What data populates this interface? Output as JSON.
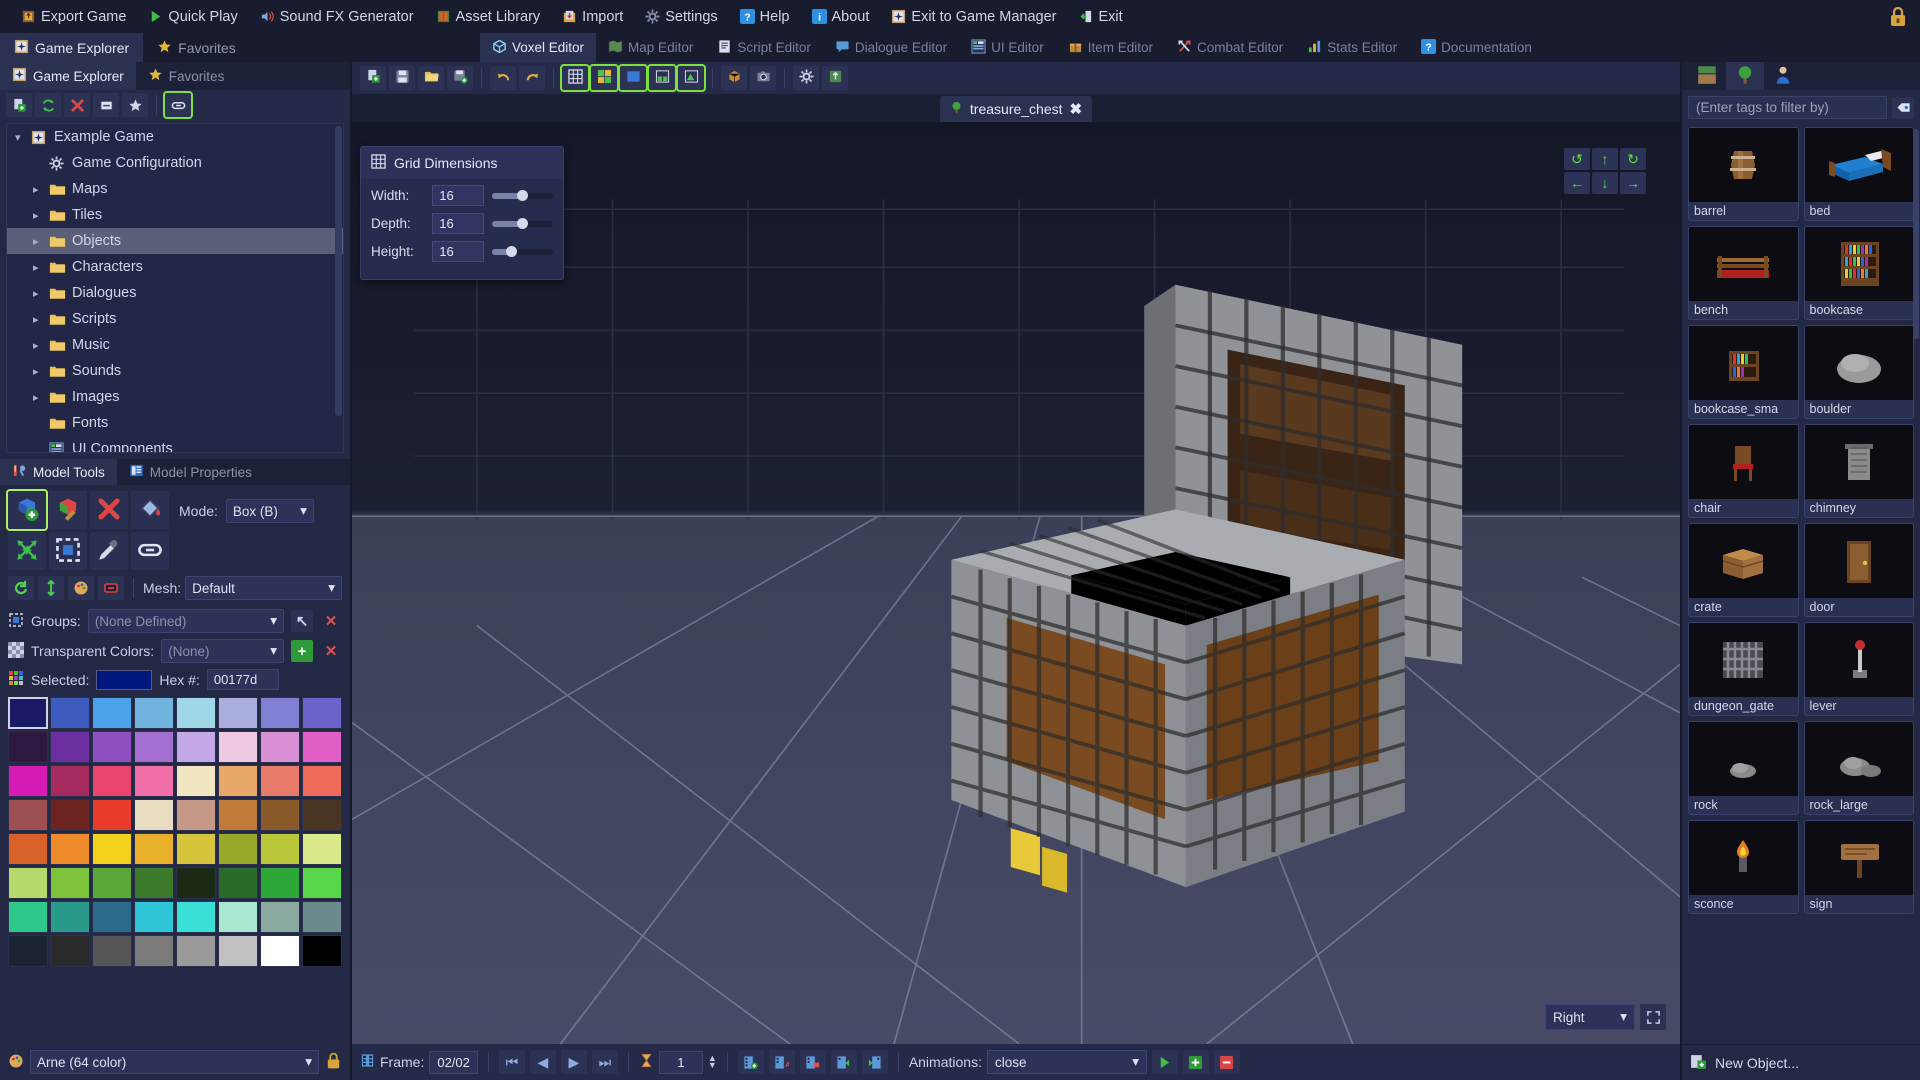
{
  "menubar": {
    "items": [
      {
        "label": "Export Game",
        "icon": "export-icon",
        "color": "#c87a2a"
      },
      {
        "label": "Quick Play",
        "icon": "play-icon",
        "color": "#3fbf4a"
      },
      {
        "label": "Sound FX Generator",
        "icon": "speaker-icon",
        "color": "#5b9be0"
      },
      {
        "label": "Asset Library",
        "icon": "library-icon",
        "color": "#4f9a4f"
      },
      {
        "label": "Import",
        "icon": "import-icon",
        "color": "#d08a2a"
      },
      {
        "label": "Settings",
        "icon": "gear-icon",
        "color": "#8b93b5"
      },
      {
        "label": "Help",
        "icon": "question-icon",
        "color": "#2f8fe0"
      },
      {
        "label": "About",
        "icon": "info-icon",
        "color": "#2f8fe0"
      },
      {
        "label": "Exit to Game Manager",
        "icon": "compass-icon",
        "color": "#c8a06a"
      },
      {
        "label": "Exit",
        "icon": "exit-door-icon",
        "color": "#3fbf4a"
      }
    ],
    "lock_icon": "lock-icon"
  },
  "editor_tabs": {
    "left": [
      {
        "label": "Game Explorer",
        "icon": "compass-icon",
        "active": true
      },
      {
        "label": "Favorites",
        "icon": "star-icon",
        "active": false
      }
    ],
    "center": [
      {
        "label": "Voxel Editor",
        "icon": "cube-icon",
        "active": true
      },
      {
        "label": "Map Editor",
        "icon": "map-icon",
        "active": false
      },
      {
        "label": "Script Editor",
        "icon": "script-icon",
        "active": false
      },
      {
        "label": "Dialogue Editor",
        "icon": "dialogue-icon",
        "active": false
      },
      {
        "label": "UI Editor",
        "icon": "ui-icon",
        "active": false
      },
      {
        "label": "Item Editor",
        "icon": "item-icon",
        "active": false
      },
      {
        "label": "Combat Editor",
        "icon": "combat-icon",
        "active": false
      },
      {
        "label": "Stats Editor",
        "icon": "stats-icon",
        "active": false
      },
      {
        "label": "Documentation",
        "icon": "question-icon",
        "active": false
      }
    ]
  },
  "explorer": {
    "toolbar": [
      {
        "name": "new-item-button",
        "icon": "new-file-icon"
      },
      {
        "name": "refresh-button",
        "icon": "refresh-icon"
      },
      {
        "name": "delete-button",
        "icon": "close-x-icon"
      },
      {
        "name": "collapse-button",
        "icon": "minus-box-icon"
      },
      {
        "name": "favorite-button",
        "icon": "star-icon"
      },
      {
        "name": "link-button",
        "icon": "link-icon",
        "selected": true
      }
    ],
    "tree": [
      {
        "label": "Example Game",
        "depth": 0,
        "icon": "compass-icon",
        "arrow": "down",
        "selected": false
      },
      {
        "label": "Game Configuration",
        "depth": 1,
        "icon": "gear-icon",
        "arrow": "",
        "selected": false
      },
      {
        "label": "Maps",
        "depth": 1,
        "icon": "folder-icon",
        "arrow": "right",
        "selected": false
      },
      {
        "label": "Tiles",
        "depth": 1,
        "icon": "folder-icon",
        "arrow": "right",
        "selected": false
      },
      {
        "label": "Objects",
        "depth": 1,
        "icon": "folder-icon",
        "arrow": "right",
        "selected": true
      },
      {
        "label": "Characters",
        "depth": 1,
        "icon": "folder-icon",
        "arrow": "right",
        "selected": false
      },
      {
        "label": "Dialogues",
        "depth": 1,
        "icon": "folder-icon",
        "arrow": "right",
        "selected": false
      },
      {
        "label": "Scripts",
        "depth": 1,
        "icon": "folder-icon",
        "arrow": "right",
        "selected": false
      },
      {
        "label": "Music",
        "depth": 1,
        "icon": "folder-icon",
        "arrow": "right",
        "selected": false
      },
      {
        "label": "Sounds",
        "depth": 1,
        "icon": "folder-icon",
        "arrow": "right",
        "selected": false
      },
      {
        "label": "Images",
        "depth": 1,
        "icon": "folder-icon",
        "arrow": "right",
        "selected": false
      },
      {
        "label": "Fonts",
        "depth": 1,
        "icon": "folder-icon",
        "arrow": "",
        "selected": false
      },
      {
        "label": "UI Components",
        "depth": 1,
        "icon": "ui-icon",
        "arrow": "",
        "selected": false
      }
    ]
  },
  "model_tools": {
    "tabs": [
      {
        "label": "Model Tools",
        "icon": "tools-icon",
        "active": true
      },
      {
        "label": "Model Properties",
        "icon": "properties-icon",
        "active": false
      }
    ],
    "tools": [
      {
        "name": "add-voxel-tool",
        "icon": "add-cube-icon",
        "selected": true
      },
      {
        "name": "paint-voxel-tool",
        "icon": "paint-cube-icon",
        "selected": false
      },
      {
        "name": "delete-voxel-tool",
        "icon": "close-x-icon",
        "selected": false
      },
      {
        "name": "fill-tool",
        "icon": "paint-bucket-icon",
        "selected": false
      },
      {
        "name": "move-tool",
        "icon": "move-arrows-icon",
        "selected": false
      },
      {
        "name": "select-tool",
        "icon": "marquee-select-icon",
        "selected": false
      },
      {
        "name": "eyedropper-tool",
        "icon": "eyedropper-icon",
        "selected": false
      },
      {
        "name": "link-tool",
        "icon": "link-icon",
        "selected": false
      }
    ],
    "mode_label": "Mode:",
    "mode_value": "Box (B)",
    "subtools": [
      {
        "name": "rotate-button",
        "icon": "rotate-icon"
      },
      {
        "name": "reposition-button",
        "icon": "move-vertical-icon"
      },
      {
        "name": "palette-button",
        "icon": "palette-icon"
      },
      {
        "name": "remove-button",
        "icon": "minus-box-icon"
      }
    ],
    "mesh_label": "Mesh:",
    "mesh_value": "Default",
    "groups_label": "Groups:",
    "groups_value": "(None Defined)",
    "transparent_label": "Transparent Colors:",
    "transparent_value": "(None)",
    "selected_label": "Selected:",
    "selected_color": "#00177d",
    "hex_label": "Hex #:",
    "hex_value": "00177d"
  },
  "palette": {
    "name": "Arne (64 color)",
    "lock_icon": "lock-icon",
    "colors": [
      "#1a1a66",
      "#3b5bbf",
      "#4aa3e8",
      "#6fb3de",
      "#9fd6e8",
      "#a8aede",
      "#7f7fd4",
      "#6b63c9",
      "#2e1a40",
      "#6b2fa0",
      "#8e4fc0",
      "#a36fd0",
      "#c4a8e8",
      "#efc9e0",
      "#d98fd4",
      "#e060c8",
      "#d61ab5",
      "#a52b5e",
      "#e8456e",
      "#f06fa8",
      "#f2e6c2",
      "#e8a86a",
      "#e87a6a",
      "#f06a5a",
      "#9e4f52",
      "#6b2420",
      "#e83c2a",
      "#e8ddc0",
      "#c79a88",
      "#c07a3a",
      "#8a5a2a",
      "#4a3522",
      "#d6622a",
      "#ef8a2a",
      "#f2d21a",
      "#e8b02a",
      "#d6c43a",
      "#9aa82a",
      "#b8c63a",
      "#dbe88a",
      "#b5d96a",
      "#7ec43a",
      "#5aa83a",
      "#3a7a2a",
      "#1a2a14",
      "#2a6b2a",
      "#2fa83a",
      "#5ad64a",
      "#2ec98a",
      "#2a9a8a",
      "#2a6a8a",
      "#2ec6d6",
      "#3ae0d6",
      "#a8e8d0",
      "#8aaaa0",
      "#6b8a8a",
      "#1a2430",
      "#2a2a2a",
      "#565656",
      "#7a7a7a",
      "#9a9a9a",
      "#c0c0c0",
      "#ffffff",
      "#000000"
    ],
    "selected_index": 0
  },
  "viewport_toolbar": {
    "buttons": [
      {
        "name": "new-model-button",
        "icon": "new-file-icon",
        "on": false
      },
      {
        "name": "save-model-button",
        "icon": "save-icon",
        "on": false
      },
      {
        "name": "open-model-button",
        "icon": "open-folder-icon",
        "on": false
      },
      {
        "name": "save-as-button",
        "icon": "save-as-icon",
        "on": false
      },
      {
        "name": "undo-button",
        "icon": "undo-icon",
        "on": false
      },
      {
        "name": "redo-button",
        "icon": "redo-icon",
        "on": false
      },
      {
        "name": "toggle-grid-button",
        "icon": "grid-icon",
        "on": true
      },
      {
        "name": "toggle-axis-button",
        "icon": "axis-icon",
        "on": true
      },
      {
        "name": "toggle-plane-button",
        "icon": "plane-icon",
        "on": true
      },
      {
        "name": "toggle-floor-button",
        "icon": "floor-icon",
        "on": true
      },
      {
        "name": "toggle-shade-button",
        "icon": "shade-icon",
        "on": true
      },
      {
        "name": "rotate-view-button",
        "icon": "cube-rotate-icon",
        "on": false
      },
      {
        "name": "screenshot-button",
        "icon": "camera-icon",
        "on": false
      },
      {
        "name": "settings-button",
        "icon": "gear-icon",
        "on": false
      },
      {
        "name": "export-model-button",
        "icon": "export-box-icon",
        "on": false
      }
    ]
  },
  "document": {
    "tab_label": "treasure_chest",
    "tab_icon": "tree-icon",
    "close_icon": "close-icon"
  },
  "grid_dimensions": {
    "title": "Grid Dimensions",
    "icon": "grid-icon",
    "rows": [
      {
        "label": "Width:",
        "value": "16",
        "fill_pct": 50
      },
      {
        "label": "Depth:",
        "value": "16",
        "fill_pct": 50
      },
      {
        "label": "Height:",
        "value": "16",
        "fill_pct": 32
      }
    ]
  },
  "nav_pad": {
    "buttons": [
      {
        "name": "rotate-left-button",
        "glyph": "↺"
      },
      {
        "name": "pan-up-button",
        "glyph": "↑"
      },
      {
        "name": "rotate-right-button",
        "glyph": "↻"
      },
      {
        "name": "pan-left-button",
        "glyph": "←"
      },
      {
        "name": "pan-down-button",
        "glyph": "↓"
      },
      {
        "name": "pan-right-button",
        "glyph": "→"
      }
    ]
  },
  "view_selector": {
    "value": "Right",
    "fit_icon": "fit-screen-icon"
  },
  "statusbar": {
    "frame_icon": "film-icon",
    "frame_label": "Frame:",
    "frame_value": "02/02",
    "nav": [
      {
        "name": "first-frame-button",
        "glyph": "⏮"
      },
      {
        "name": "prev-frame-button",
        "glyph": "◀"
      },
      {
        "name": "next-frame-button",
        "glyph": "▶"
      },
      {
        "name": "last-frame-button",
        "glyph": "⏭"
      }
    ],
    "duration_icon": "hourglass-icon",
    "duration_value": "1",
    "frame_ops": [
      {
        "name": "add-frame-button",
        "icon": "add-frame-icon"
      },
      {
        "name": "duplicate-frame-button",
        "icon": "duplicate-frame-icon"
      },
      {
        "name": "delete-frame-button",
        "icon": "delete-frame-icon"
      },
      {
        "name": "move-frame-left-button",
        "icon": "move-frame-left-icon"
      },
      {
        "name": "move-frame-right-button",
        "icon": "move-frame-right-icon"
      }
    ],
    "animations_label": "Animations:",
    "animations_value": "close",
    "anim_ops": [
      {
        "name": "play-animation-button",
        "icon": "play-icon"
      },
      {
        "name": "add-animation-button",
        "icon": "plus-icon"
      },
      {
        "name": "remove-animation-button",
        "icon": "minus-icon"
      }
    ]
  },
  "asset_panel": {
    "tabs": [
      {
        "name": "tab-tiles",
        "icon": "tile-icon",
        "active": false
      },
      {
        "name": "tab-objects",
        "icon": "tree-icon",
        "active": true
      },
      {
        "name": "tab-characters",
        "icon": "character-icon",
        "active": false
      }
    ],
    "filter_placeholder": "(Enter tags to filter by)",
    "filter_value": "",
    "filter_button_icon": "tag-icon",
    "assets": [
      {
        "label": "barrel",
        "icon": "barrel-thumb"
      },
      {
        "label": "bed",
        "icon": "bed-thumb"
      },
      {
        "label": "bench",
        "icon": "bench-thumb"
      },
      {
        "label": "bookcase",
        "icon": "bookcase-thumb"
      },
      {
        "label": "bookcase_sma",
        "icon": "bookcase-small-thumb"
      },
      {
        "label": "boulder",
        "icon": "boulder-thumb"
      },
      {
        "label": "chair",
        "icon": "chair-thumb"
      },
      {
        "label": "chimney",
        "icon": "chimney-thumb"
      },
      {
        "label": "crate",
        "icon": "crate-thumb"
      },
      {
        "label": "door",
        "icon": "door-thumb"
      },
      {
        "label": "dungeon_gate",
        "icon": "dungeon-gate-thumb"
      },
      {
        "label": "lever",
        "icon": "lever-thumb"
      },
      {
        "label": "rock",
        "icon": "rock-thumb"
      },
      {
        "label": "rock_large",
        "icon": "rock-large-thumb"
      },
      {
        "label": "sconce",
        "icon": "sconce-thumb"
      },
      {
        "label": "sign",
        "icon": "sign-thumb"
      }
    ],
    "new_object_label": "New Object...",
    "new_object_icon": "new-object-icon"
  }
}
